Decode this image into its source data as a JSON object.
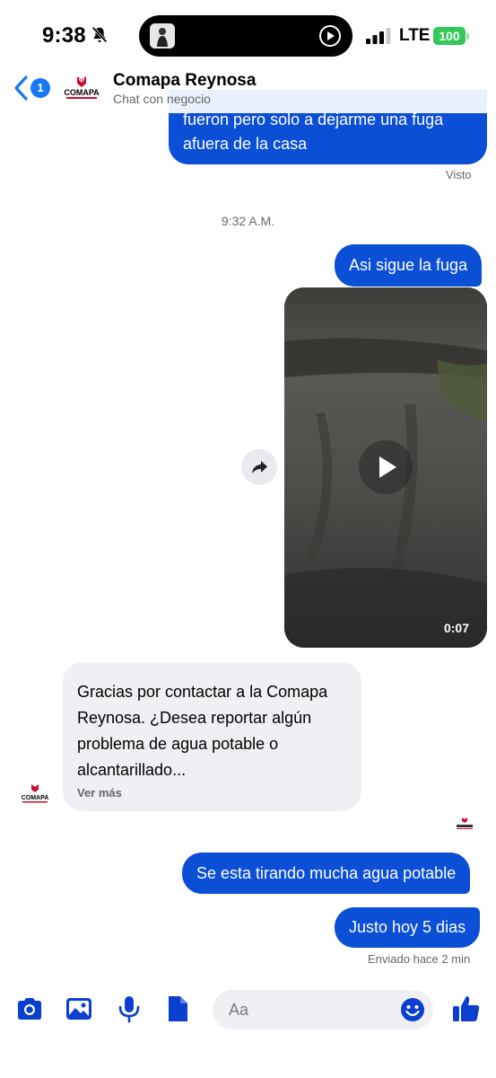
{
  "status_bar": {
    "time": "9:38",
    "network": "LTE",
    "battery": "100",
    "icons": [
      "bell-slash-icon",
      "signal-icon",
      "battery-icon",
      "play-icon"
    ]
  },
  "header": {
    "back_count": "1",
    "name": "Comapa Reynosa",
    "subtitle": "Chat con negocio",
    "logo_text": "COMAPA"
  },
  "messages": {
    "first_out_line1": "fueron pero solo a dejarme una fuga",
    "first_out_line2": "afuera de la casa",
    "seen_label": "Visto",
    "timestamp": "9:32 A.M.",
    "second_out": "Asi sigue la fuga",
    "video_duration": "0:07",
    "incoming_line1": "Gracias por contactar a la Comapa",
    "incoming_line2": "Reynosa. ¿Desea reportar algún",
    "incoming_line3": "problema de agua potable o",
    "incoming_line4": "alcantarillado...",
    "see_more": "Ver más",
    "third_out": "Se esta tirando mucha agua potable",
    "fourth_out": "Justo hoy 5 dias",
    "sent_label": "Enviado hace 2 min"
  },
  "composer": {
    "placeholder": "Aa",
    "icons": [
      "camera-icon",
      "image-icon",
      "microphone-icon",
      "file-icon",
      "emoji-icon",
      "thumbs-up-icon"
    ]
  },
  "colors": {
    "outgoing_bubble": "#0b4fd6",
    "incoming_bubble": "#f0f0f4",
    "accent": "#1877f2",
    "icon_blue": "#0a3fd0",
    "battery_green": "#34c759"
  }
}
